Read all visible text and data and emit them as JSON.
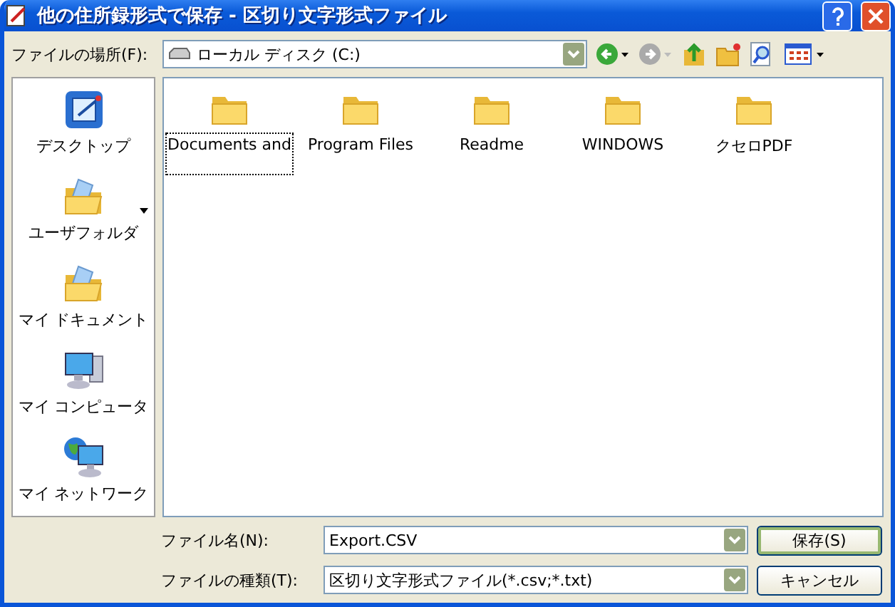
{
  "window": {
    "title": "他の住所録形式で保存 - 区切り文字形式ファイル"
  },
  "location": {
    "label": "ファイルの場所(F):",
    "value": "ローカル ディスク (C:)"
  },
  "places": [
    {
      "label": "デスクトップ",
      "kind": "desktop",
      "menu": false
    },
    {
      "label": "ユーザフォルダ",
      "kind": "folder",
      "menu": true
    },
    {
      "label": "マイ ドキュメント",
      "kind": "folder",
      "menu": false
    },
    {
      "label": "マイ コンピュータ",
      "kind": "computer",
      "menu": false
    },
    {
      "label": "マイ ネットワーク",
      "kind": "network",
      "menu": false
    }
  ],
  "folders": [
    {
      "name": "Documents and",
      "selected": true
    },
    {
      "name": "Program Files",
      "selected": false
    },
    {
      "name": "Readme",
      "selected": false
    },
    {
      "name": "WINDOWS",
      "selected": false
    },
    {
      "name": "クセロPDF",
      "selected": false
    }
  ],
  "filename": {
    "label": "ファイル名(N):",
    "value": "Export.CSV"
  },
  "filetype": {
    "label": "ファイルの種類(T):",
    "value": "区切り文字形式ファイル(*.csv;*.txt)"
  },
  "buttons": [
    {
      "label": "保存(S)",
      "default": true
    },
    {
      "label": "キャンセル",
      "default": false
    }
  ]
}
